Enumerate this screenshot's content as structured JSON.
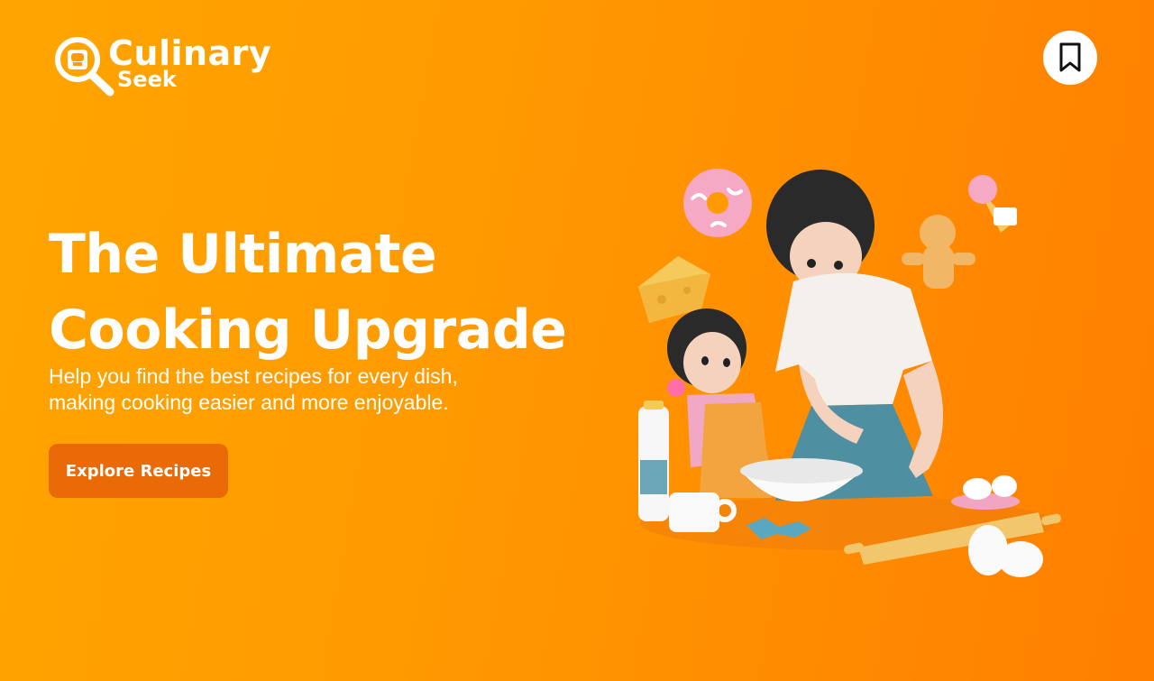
{
  "brand": {
    "name_line1": "Culinary",
    "name_line2": "Seek",
    "logo_icon": "magnifier-chef-hat-icon"
  },
  "header": {
    "bookmark_icon": "bookmark-icon"
  },
  "hero": {
    "title_line1": "The Ultimate",
    "title_line2": "Cooking Upgrade",
    "subtitle_line1": "Help you find the best recipes for every dish,",
    "subtitle_line2": "making cooking easier and more enjoyable.",
    "cta_label": "Explore Recipes"
  },
  "colors": {
    "bg_start": "#ffa500",
    "bg_end": "#ff7f00",
    "cta": "#e96a07",
    "text": "#ffffff"
  }
}
